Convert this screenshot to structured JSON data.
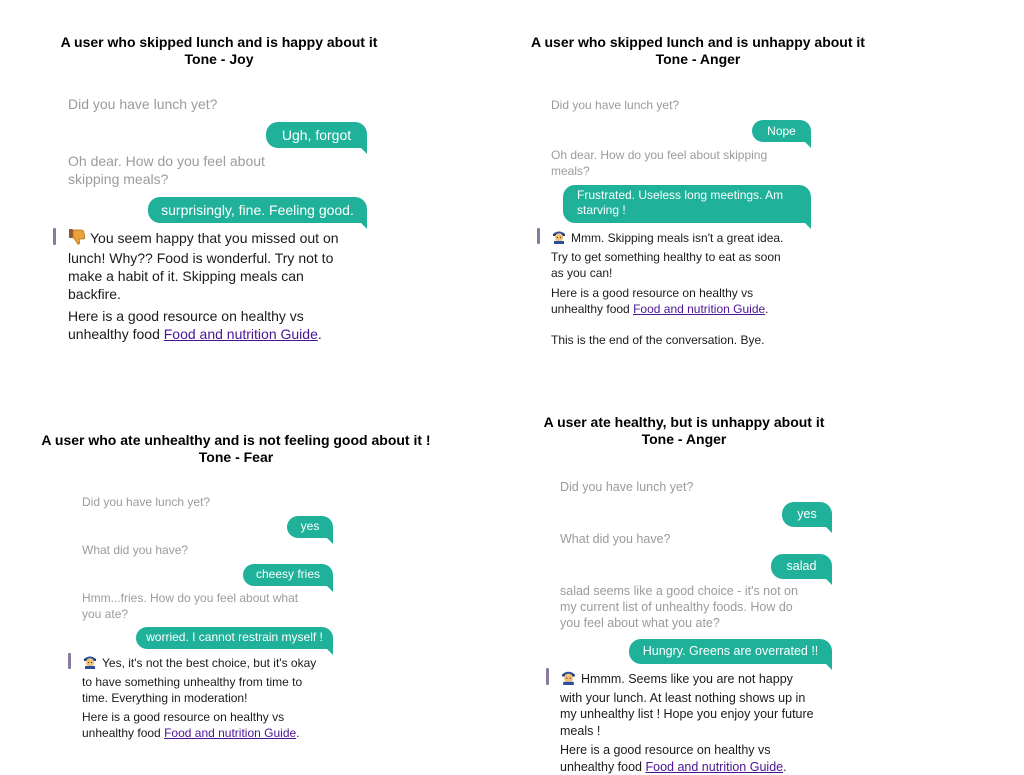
{
  "colors": {
    "bubble": "#1fb19a",
    "bot_text": "#9b9b9b",
    "response_text": "#1b1b1b",
    "link": "#4b1493",
    "bar": "#8a7aa0"
  },
  "panels": [
    {
      "title_line1": "A user who skipped lunch and is happy about it",
      "title_line2": "Tone - Joy",
      "q1": "Did you have lunch yet?",
      "a1": "Ugh, forgot",
      "q2": "Oh dear. How do you feel about skipping meals?",
      "a2": "surprisingly, fine. Feeling good.",
      "emoji_icon": "thumbs-down-icon",
      "response": "You seem happy that you missed out on lunch! Why?? Food is wonderful. Try not to make a habit of it. Skipping meals can backfire.",
      "resource_text": "Here is a good resource on healthy vs unhealthy food",
      "link_text": "Food and nutrition Guide",
      "link_suffix": "."
    },
    {
      "title_line1": "A user who skipped lunch and is unhappy about it",
      "title_line2": "Tone - Anger",
      "q1": "Did you have lunch yet?",
      "a1": "Nope",
      "q2": "Oh dear. How do you feel about skipping meals?",
      "a2": "Frustrated. Useless long meetings. Am starving !",
      "emoji_icon": "police-officer-icon",
      "response": "Mmm. Skipping meals isn't a great idea. Try to get something healthy to eat as soon as you can!",
      "resource_text": "Here is a good resource on healthy vs unhealthy food",
      "link_text": "Food and nutrition Guide",
      "link_suffix": ".",
      "ending": "This is the end of the conversation. Bye."
    },
    {
      "title_line1": "A user who ate unhealthy and is not feeling good about it !",
      "title_line2": "Tone - Fear",
      "q1": "Did you have lunch yet?",
      "a1": "yes",
      "q2": "What did you have?",
      "a2": "cheesy fries",
      "q3": "Hmm...fries. How do you feel about what you ate?",
      "a3": "worried. I cannot restrain myself !",
      "emoji_icon": "police-officer-icon",
      "response": "Yes, it's not the best choice, but it's okay to have something unhealthy from time to time. Everything in moderation!",
      "resource_text": "Here is a good resource on healthy vs unhealthy food",
      "link_text": "Food and nutrition Guide",
      "link_suffix": "."
    },
    {
      "title_line1": "A user ate healthy, but is unhappy about it",
      "title_line2": "Tone - Anger",
      "q1": "Did you have lunch yet?",
      "a1": "yes",
      "q2": "What did you have?",
      "a2": "salad",
      "q3": "salad seems like a good choice - it's not on my current list of unhealthy foods. How do you feel about what you ate?",
      "a3": "Hungry. Greens are overrated !!",
      "emoji_icon": "police-officer-icon",
      "response": "Hmmm. Seems like you are not happy with your lunch. At least nothing shows up in my unhealthy list ! Hope you enjoy your future meals !",
      "resource_text": "Here is a good resource on healthy vs unhealthy food",
      "link_text": "Food and nutrition Guide",
      "link_suffix": "."
    }
  ]
}
